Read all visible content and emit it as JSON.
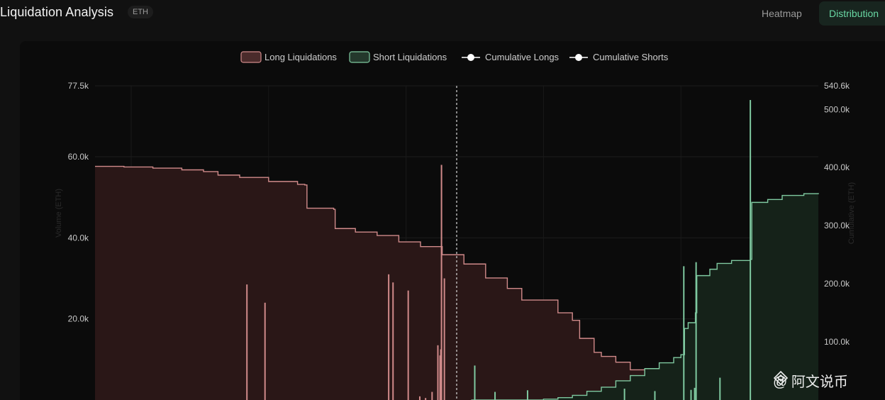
{
  "header": {
    "title": "Liquidation Analysis",
    "asset_badge": "ETH",
    "tabs": [
      {
        "label": "Heatmap",
        "active": false
      },
      {
        "label": "Distribution",
        "active": true
      }
    ]
  },
  "colors": {
    "long": "#d08a8a",
    "long_fill": "#2a1717",
    "short": "#7fc9a0",
    "short_fill": "#152219",
    "accent": "#69d8a4",
    "marker": "#ffffff"
  },
  "watermark": {
    "text": "@ 阿文说币",
    "icon": "binance-diamond-icon"
  },
  "chart_data": {
    "type": "bar",
    "legend": [
      {
        "name": "Long Liquidations",
        "kind": "bar",
        "color": "#d08a8a"
      },
      {
        "name": "Short Liquidations",
        "kind": "bar",
        "color": "#7fc9a0"
      },
      {
        "name": "Cumulative Longs",
        "kind": "line",
        "color": "#ffffff"
      },
      {
        "name": "Cumulative Shorts",
        "kind": "line",
        "color": "#ffffff"
      }
    ],
    "legend_position": "top-center",
    "grid": true,
    "y_left": {
      "label": "Volume (ETH)",
      "ticks": [
        "20.0k",
        "40.0k",
        "60.0k",
        "77.5k"
      ],
      "tick_values": [
        20000,
        40000,
        60000,
        77500
      ],
      "range": [
        0,
        77500
      ]
    },
    "y_right": {
      "label": "Cumulative (ETH)",
      "ticks": [
        "100.0k",
        "200.0k",
        "300.0k",
        "400.0k",
        "500.0k",
        "540.6k"
      ],
      "tick_values": [
        100000,
        200000,
        300000,
        400000,
        500000,
        540600
      ],
      "range": [
        0,
        540600
      ]
    },
    "x_range": [
      0,
      100
    ],
    "current_price_x": 50,
    "long_bars": [
      {
        "x": 21,
        "value": 28500
      },
      {
        "x": 23.5,
        "value": 24000
      },
      {
        "x": 40.6,
        "value": 31000
      },
      {
        "x": 41.2,
        "value": 29000
      },
      {
        "x": 43.3,
        "value": 27000
      },
      {
        "x": 46.6,
        "value": 2000
      },
      {
        "x": 47.4,
        "value": 13500
      },
      {
        "x": 47.7,
        "value": 11000
      },
      {
        "x": 47.8,
        "value": 12500
      },
      {
        "x": 47.9,
        "value": 58000
      },
      {
        "x": 48.3,
        "value": 30000
      },
      {
        "x": 44.9,
        "value": 900
      },
      {
        "x": 45.7,
        "value": 500
      }
    ],
    "short_bars": [
      {
        "x": 52.5,
        "value": 8500
      },
      {
        "x": 55.3,
        "value": 2000
      },
      {
        "x": 59.8,
        "value": 2400
      },
      {
        "x": 73.2,
        "value": 2800
      },
      {
        "x": 77.4,
        "value": 2200
      },
      {
        "x": 81.4,
        "value": 33000
      },
      {
        "x": 82.4,
        "value": 2500
      },
      {
        "x": 82.9,
        "value": 3000
      },
      {
        "x": 83.1,
        "value": 34000
      },
      {
        "x": 86.4,
        "value": 5500
      },
      {
        "x": 90.6,
        "value": 74000
      }
    ],
    "cumulative_longs": [
      {
        "x": 0,
        "y": 402000
      },
      {
        "x": 4,
        "y": 401000
      },
      {
        "x": 8,
        "y": 399000
      },
      {
        "x": 12,
        "y": 396000
      },
      {
        "x": 15,
        "y": 393000
      },
      {
        "x": 17,
        "y": 387000
      },
      {
        "x": 20,
        "y": 383000
      },
      {
        "x": 24,
        "y": 376000
      },
      {
        "x": 28,
        "y": 371000
      },
      {
        "x": 29,
        "y": 370000
      },
      {
        "x": 29.3,
        "y": 330000
      },
      {
        "x": 33,
        "y": 328000
      },
      {
        "x": 33.2,
        "y": 295000
      },
      {
        "x": 36,
        "y": 289000
      },
      {
        "x": 39,
        "y": 283000
      },
      {
        "x": 42,
        "y": 272000
      },
      {
        "x": 45,
        "y": 264000
      },
      {
        "x": 48,
        "y": 250000
      },
      {
        "x": 51,
        "y": 234000
      },
      {
        "x": 54,
        "y": 210000
      },
      {
        "x": 57,
        "y": 192000
      },
      {
        "x": 59,
        "y": 172000
      },
      {
        "x": 64,
        "y": 150000
      },
      {
        "x": 66,
        "y": 137000
      },
      {
        "x": 67,
        "y": 106000
      },
      {
        "x": 69,
        "y": 82000
      },
      {
        "x": 70,
        "y": 75000
      },
      {
        "x": 72,
        "y": 65000
      },
      {
        "x": 74,
        "y": 52000
      },
      {
        "x": 76,
        "y": 38000
      },
      {
        "x": 77.5,
        "y": 22000
      },
      {
        "x": 78,
        "y": 5000
      }
    ],
    "cumulative_shorts": [
      {
        "x": 52,
        "y": 0
      },
      {
        "x": 62,
        "y": 1500
      },
      {
        "x": 64,
        "y": 4000
      },
      {
        "x": 66,
        "y": 8000
      },
      {
        "x": 68,
        "y": 15000
      },
      {
        "x": 70,
        "y": 22000
      },
      {
        "x": 72,
        "y": 33000
      },
      {
        "x": 74,
        "y": 42000
      },
      {
        "x": 76,
        "y": 54000
      },
      {
        "x": 78,
        "y": 64000
      },
      {
        "x": 80,
        "y": 73000
      },
      {
        "x": 81,
        "y": 78000
      },
      {
        "x": 81.5,
        "y": 123000
      },
      {
        "x": 82,
        "y": 133000
      },
      {
        "x": 83,
        "y": 150000
      },
      {
        "x": 83.2,
        "y": 214000
      },
      {
        "x": 85,
        "y": 225000
      },
      {
        "x": 86,
        "y": 235000
      },
      {
        "x": 88,
        "y": 240000
      },
      {
        "x": 90.6,
        "y": 242000
      },
      {
        "x": 90.8,
        "y": 340000
      },
      {
        "x": 93,
        "y": 345000
      },
      {
        "x": 95,
        "y": 352000
      },
      {
        "x": 98,
        "y": 355000
      },
      {
        "x": 100,
        "y": 356000
      }
    ]
  }
}
